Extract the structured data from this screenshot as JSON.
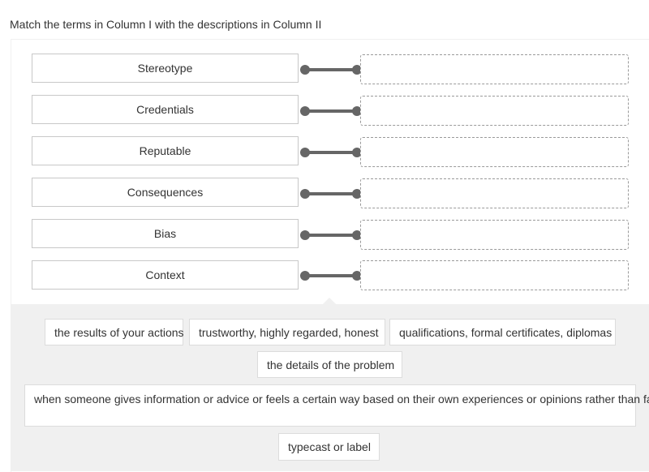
{
  "instruction": "Match the terms in Column I with the descriptions in Column II",
  "column_one": [
    {
      "label": "Stereotype",
      "matched": null
    },
    {
      "label": "Credentials",
      "matched": null
    },
    {
      "label": "Reputable",
      "matched": null
    },
    {
      "label": "Consequences",
      "matched": null
    },
    {
      "label": "Bias",
      "matched": null
    },
    {
      "label": "Context",
      "matched": null
    }
  ],
  "answer_bank": [
    {
      "label": "the results of your actions"
    },
    {
      "label": "trustworthy, highly regarded, honest"
    },
    {
      "label": "qualifications, formal certificates, diplomas"
    },
    {
      "label": "the details of the problem"
    },
    {
      "label": "when someone gives information or advice or feels a certain way based on their own experiences or opinions rather than fact"
    },
    {
      "label": "typecast or label"
    }
  ],
  "colors": {
    "connector": "#666666",
    "bank_bg": "#f0f0f0",
    "slot_border": "#9a9a9a"
  }
}
